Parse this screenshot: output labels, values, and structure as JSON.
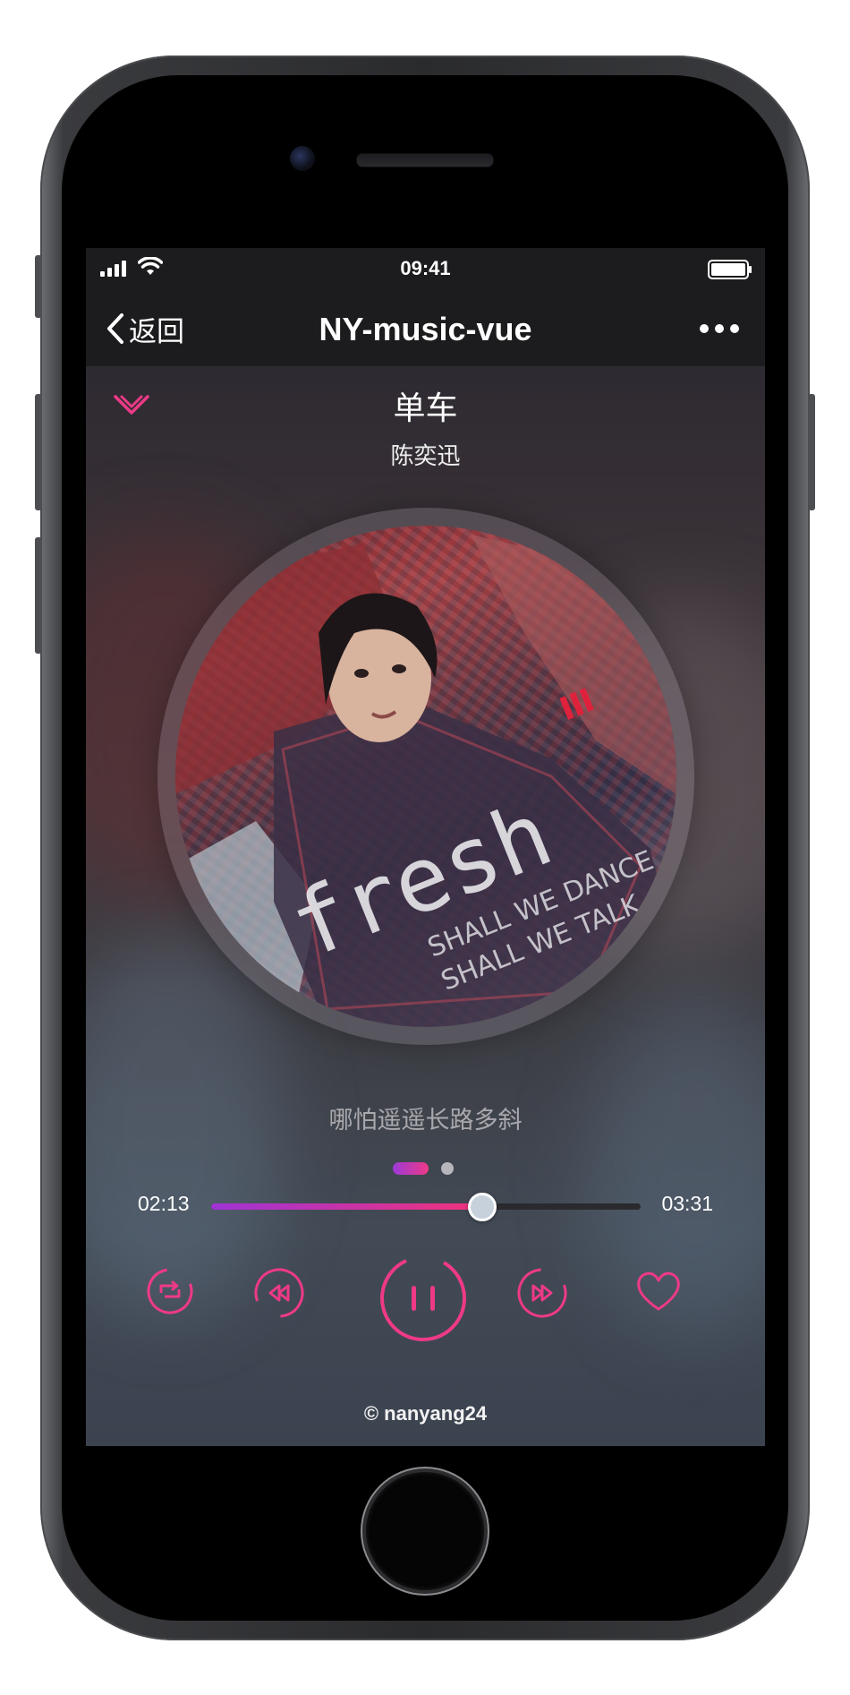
{
  "status_bar": {
    "time": "09:41"
  },
  "nav": {
    "back_label": "返回",
    "title": "NY-music-vue"
  },
  "song": {
    "title": "单车",
    "artist": "陈奕迅"
  },
  "lyric": {
    "current_line": "哪怕遥遥长路多斜"
  },
  "pager": {
    "active_index": 0,
    "count": 2
  },
  "progress": {
    "current_time": "02:13",
    "total_time": "03:31",
    "fraction": 0.63
  },
  "controls": {
    "mode_icon": "loop-icon",
    "prev_icon": "previous-icon",
    "play_state": "playing",
    "next_icon": "next-icon",
    "favorite_icon": "heart-icon"
  },
  "colors": {
    "accent": "#ee3a86",
    "accent_gradient_start": "#a033d6",
    "screen_bg": "#1c1c1e"
  },
  "footer": {
    "text": "© nanyang24"
  }
}
